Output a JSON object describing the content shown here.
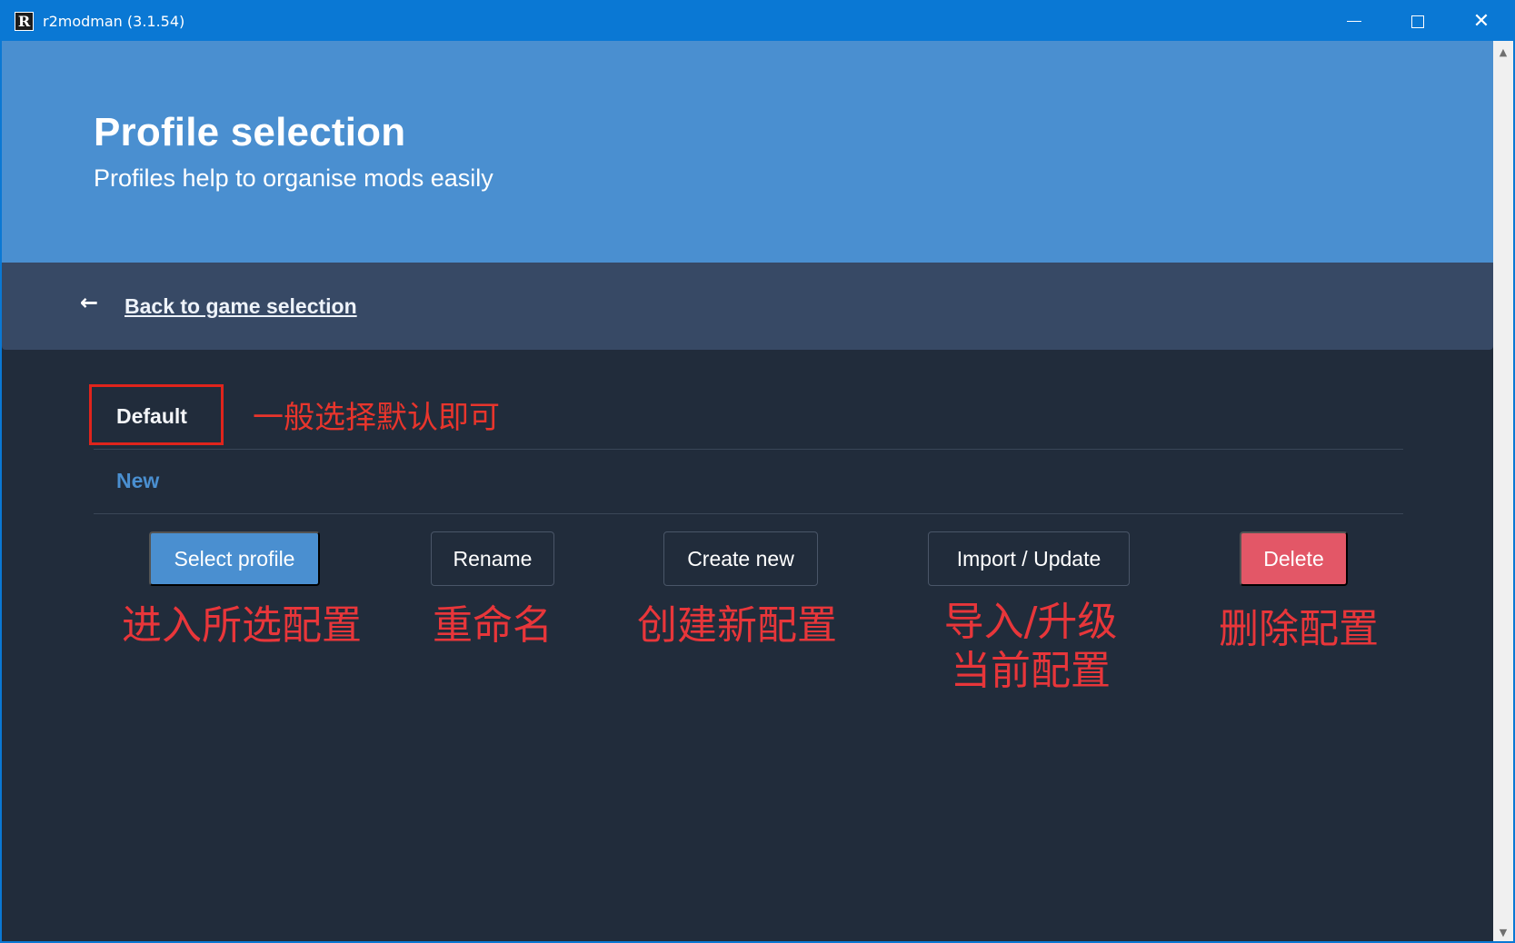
{
  "window": {
    "app_icon_letter": "R",
    "title": "r2modman (3.1.54)",
    "minimize": "",
    "maximize": "",
    "close": "✕"
  },
  "hero": {
    "title": "Profile selection",
    "subtitle": "Profiles help to organise mods easily"
  },
  "nav": {
    "back_icon": "←",
    "back_label": "Back to game selection"
  },
  "profiles": [
    {
      "name": "Default",
      "selected": true
    },
    {
      "name": "New",
      "selected": false
    }
  ],
  "annotations": {
    "default": "一般选择默认即可",
    "select": "进入所选配置",
    "rename": "重命名",
    "create": "创建新配置",
    "import": "导入/升级\n当前配置",
    "delete": "删除配置"
  },
  "buttons": {
    "select": "Select profile",
    "rename": "Rename",
    "create": "Create new",
    "import": "Import / Update",
    "delete": "Delete"
  },
  "scrollbar": {
    "up": "▲",
    "down": "▼"
  },
  "colors": {
    "titlebar": "#0a78d4",
    "hero": "#4a8fd0",
    "nav": "#374965",
    "body": "#212c3b",
    "delete": "#e35767",
    "annotation": "#e8363a"
  }
}
